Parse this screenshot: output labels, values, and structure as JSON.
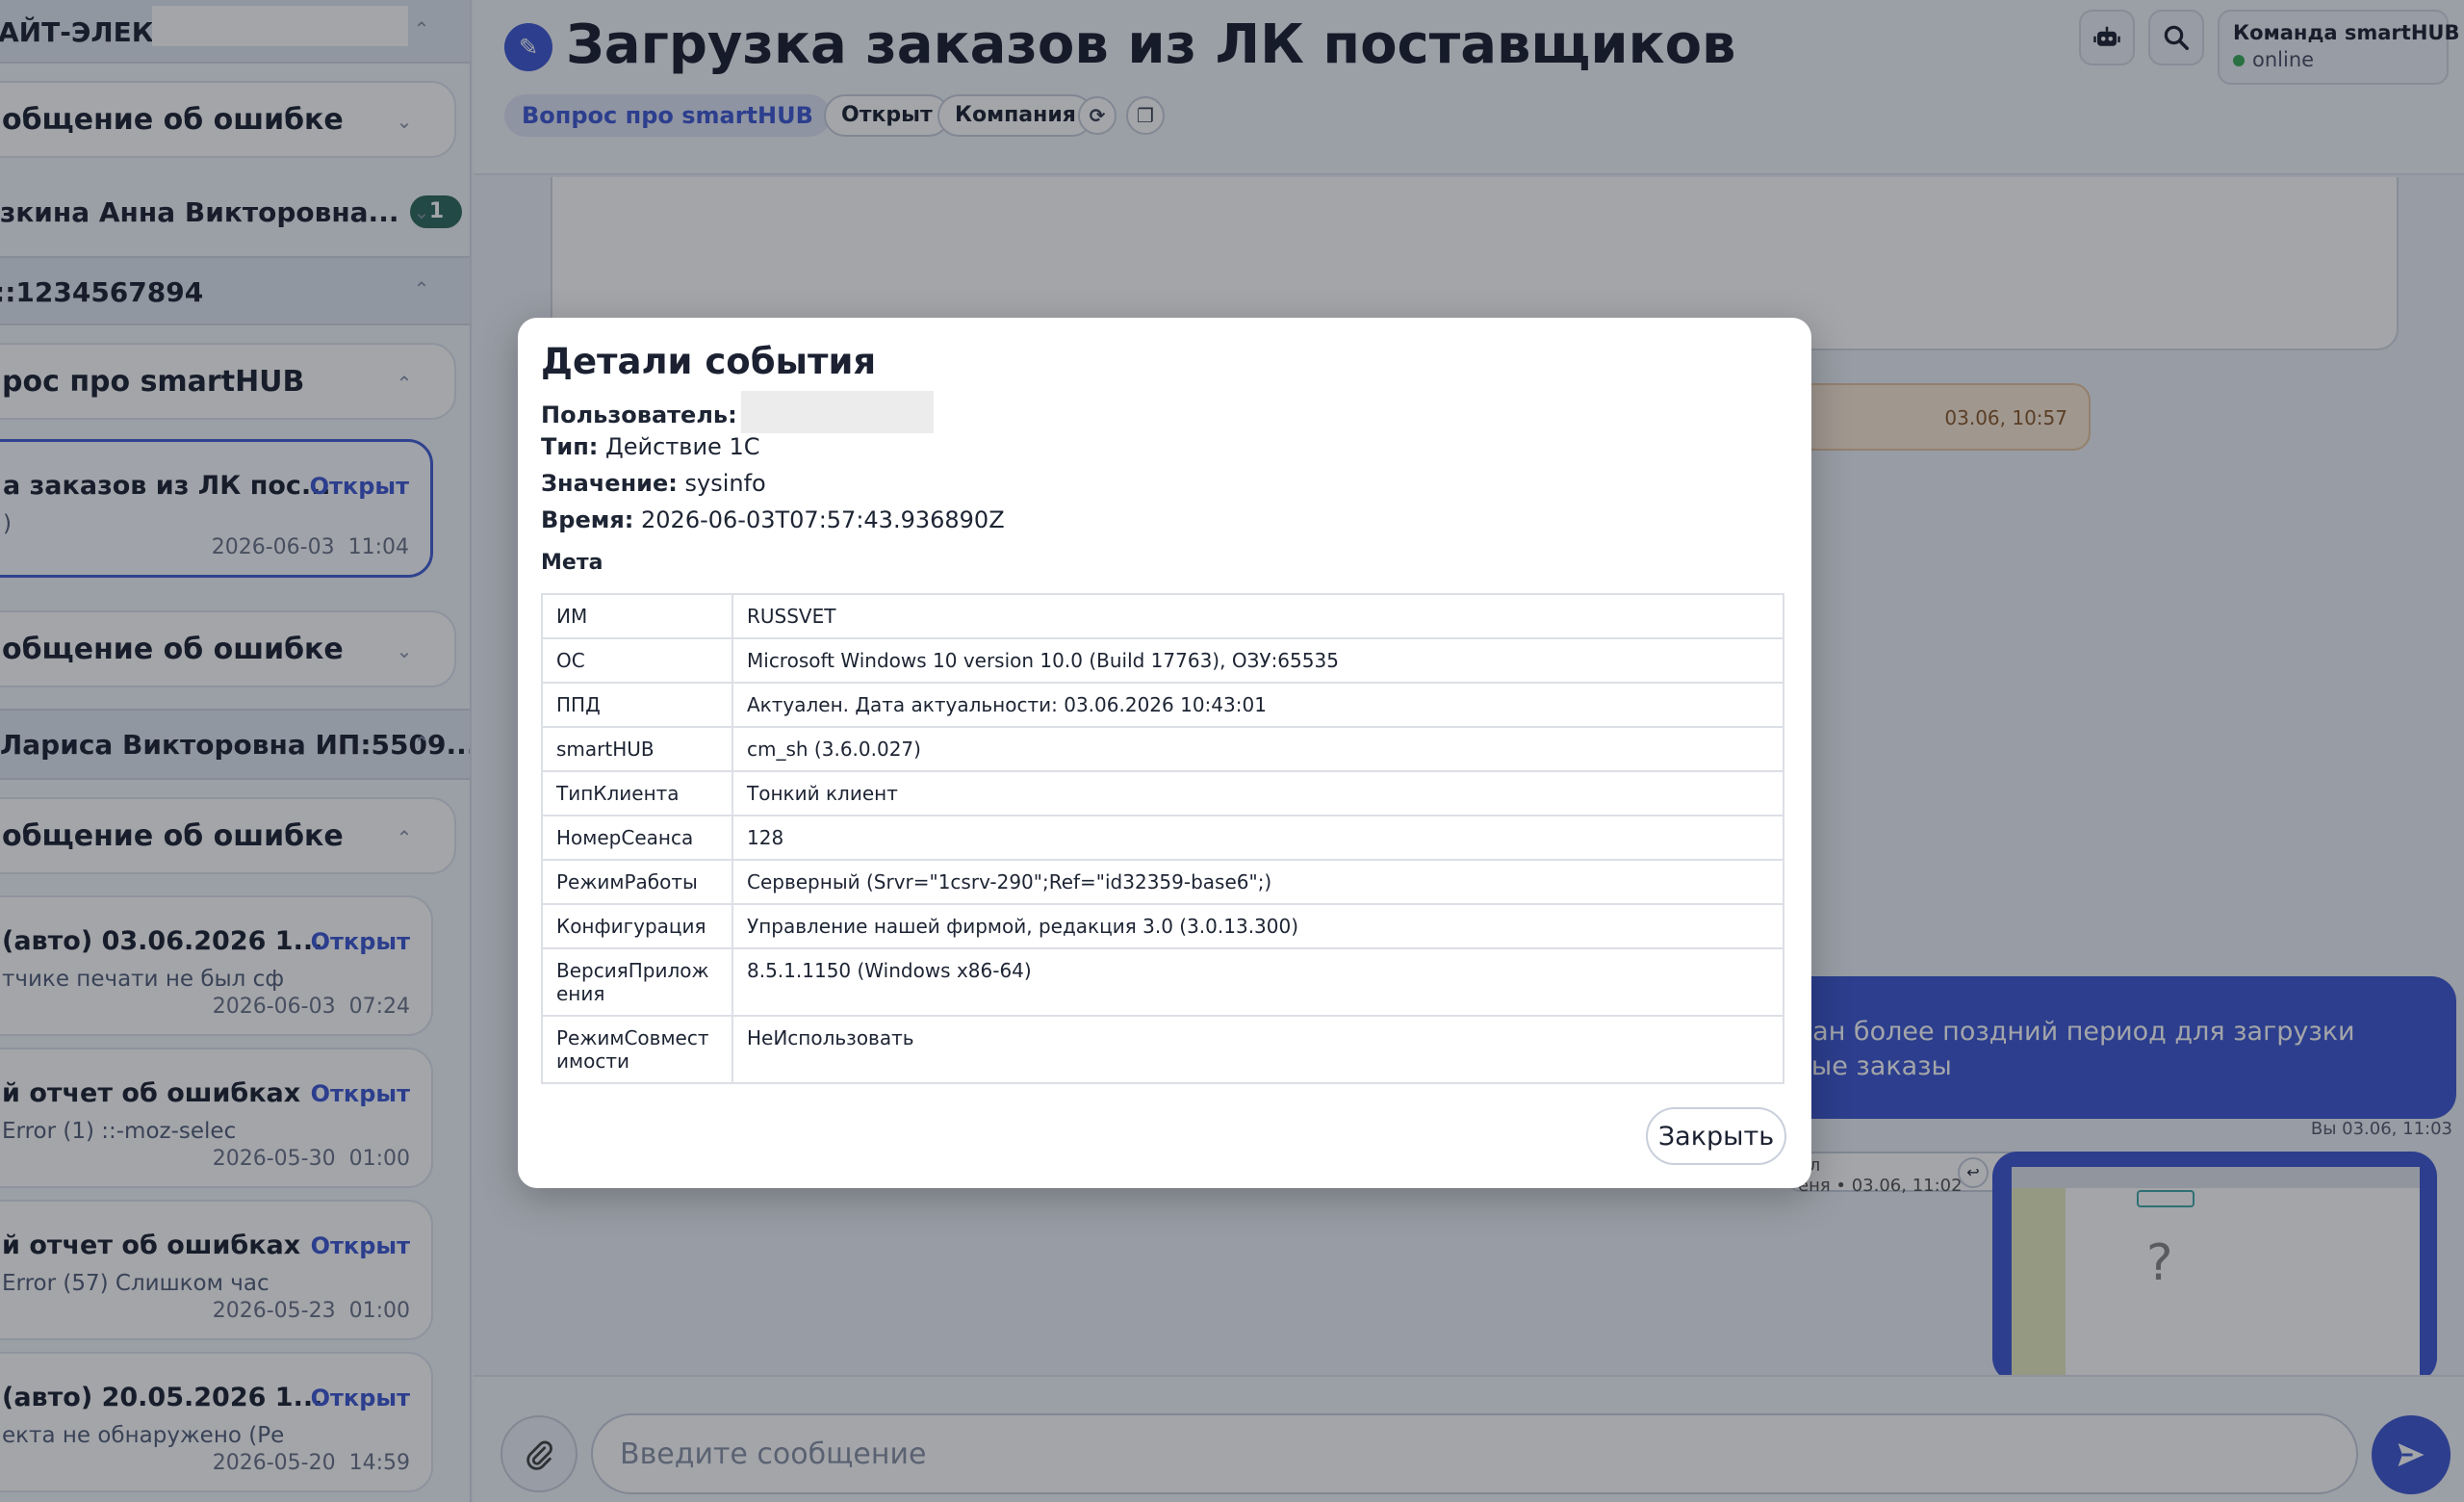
{
  "sidebar": {
    "sections": [
      {
        "label": "АЙТ-ЭЛЕКТР",
        "chevron": "^"
      },
      {
        "label": "общение об ошибке",
        "chevron": "v"
      },
      {
        "label": "зкина Анна Викторовна...",
        "badge": "1",
        "chevron": "v"
      },
      {
        "label": "::1234567894",
        "chevron": "^"
      },
      {
        "label": "рос про smartHUB",
        "chevron": "^"
      },
      {
        "label": "общение об ошибке",
        "chevron": "v"
      },
      {
        "label": "Лариса Викторовна ИП:5509...",
        "chevron": "^"
      },
      {
        "label": "общение об ошибке",
        "chevron": "^"
      }
    ],
    "cards": [
      {
        "title": "а заказов из ЛК пос...",
        "subtitle": ")",
        "status": "Открыт",
        "date": "2026-06-03",
        "time": "11:04"
      },
      {
        "title": "(авто) 03.06.2026 1...",
        "subtitle": "тчике печати не был сф",
        "status": "Открыт",
        "date": "2026-06-03",
        "time": "07:24"
      },
      {
        "title": "й отчет об ошибках",
        "subtitle": "Error (1) ::-moz-selec",
        "status": "Открыт",
        "date": "2026-05-30",
        "time": "01:00"
      },
      {
        "title": "й отчет об ошибках",
        "subtitle": "Error (57) Слишком час",
        "status": "Открыт",
        "date": "2026-05-23",
        "time": "01:00"
      },
      {
        "title": "(авто) 20.05.2026 1...",
        "subtitle": "екта не обнаружено (Ре",
        "status": "Открыт",
        "date": "2026-05-20",
        "time": "14:59"
      }
    ]
  },
  "header": {
    "title": "Загрузка заказов из ЛК поставщиков",
    "chips": {
      "topic": "Вопрос про smartHUB",
      "status": "Открыт",
      "company": "Компания"
    },
    "team": {
      "name": "Команда smartHUB",
      "status": "online"
    }
  },
  "chat": {
    "orange_time": "03.06, 10:57",
    "blue_message": {
      "line1": "е - у вас указан более поздний период для загрузки",
      "line2": "айдете нужные заказы",
      "meta": "Вы  03.06, 11:03"
    },
    "file_chip": {
      "line1": "йл",
      "line2": "еня • 03.06, 11:02"
    },
    "screenshot_mark": "?"
  },
  "composer": {
    "placeholder": "Введите сообщение"
  },
  "modal": {
    "title": "Детали события",
    "user_label": "Пользователь:",
    "type_label": "Тип:",
    "type_value": "Действие 1С",
    "value_label": "Значение:",
    "value_value": "sysinfo",
    "time_label": "Время:",
    "time_value": "2026-06-03T07:57:43.936890Z",
    "meta_label": "Мета",
    "meta_rows": [
      {
        "key": "ИМ",
        "value": "RUSSVET"
      },
      {
        "key": "ОС",
        "value": "Microsoft Windows 10 version 10.0 (Build 17763), ОЗУ:65535"
      },
      {
        "key": "ППД",
        "value": "Актуален. Дата актуальности: 03.06.2026 10:43:01"
      },
      {
        "key": "smartHUB",
        "value": "cm_sh (3.6.0.027)"
      },
      {
        "key": "ТипКлиента",
        "value": "Тонкий клиент"
      },
      {
        "key": "НомерСеанса",
        "value": "128"
      },
      {
        "key": "РежимРаботы",
        "value": "Серверный (Srvr=\"1csrv-290\";Ref=\"id32359-base6\";)"
      },
      {
        "key": "Конфигурация",
        "value": "Управление нашей фирмой, редакция 3.0 (3.0.13.300)"
      },
      {
        "key": "ВерсияПриложения",
        "value": "8.5.1.1150 (Windows x86-64)"
      },
      {
        "key": "РежимСовместимости",
        "value": "НеИспользовать"
      }
    ],
    "close_label": "Закрыть"
  },
  "icons": {
    "title_icon": "pencil-icon",
    "bot": "robot-icon",
    "search": "search-icon",
    "attach": "paperclip-icon",
    "send": "send-icon"
  }
}
